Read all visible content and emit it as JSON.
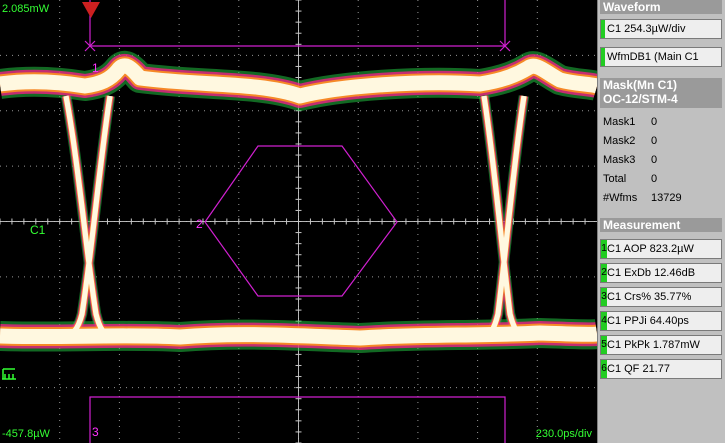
{
  "scope": {
    "top_scale": "2.085mW",
    "bottom_scale": "-457.8µW",
    "time_scale": "230.0ps/div",
    "channel_label": "C1",
    "mask_region_1": "1",
    "mask_region_2": "2",
    "mask_region_3": "3",
    "colors": {
      "trace": "#fff8e0",
      "grid": "#c8c8c8",
      "mask": "#d020d0",
      "label": "#33ff33"
    }
  },
  "panel": {
    "waveform": {
      "header": "Waveform",
      "items": [
        "C1 254.3µW/div",
        "WfmDB1 (Main C1"
      ]
    },
    "mask": {
      "header_line1": "Mask(Mn C1)",
      "header_line2": "OC-12/STM-4",
      "rows": [
        {
          "label": "Mask1",
          "value": "0"
        },
        {
          "label": "Mask2",
          "value": "0"
        },
        {
          "label": "Mask3",
          "value": "0"
        },
        {
          "label": "Total",
          "value": "0"
        },
        {
          "label": "#Wfms",
          "value": "13729"
        }
      ]
    },
    "measurement": {
      "header": "Measurement",
      "items": [
        {
          "num": "1",
          "text": "C1 AOP  823.2µW"
        },
        {
          "num": "2",
          "text": "C1 ExDb  12.46dB"
        },
        {
          "num": "3",
          "text": "C1 Crs%  35.77%"
        },
        {
          "num": "4",
          "text": "C1 PPJi  64.40ps"
        },
        {
          "num": "5",
          "text": "C1 PkPk  1.787mW"
        },
        {
          "num": "6",
          "text": "C1 QF    21.77"
        }
      ]
    }
  }
}
